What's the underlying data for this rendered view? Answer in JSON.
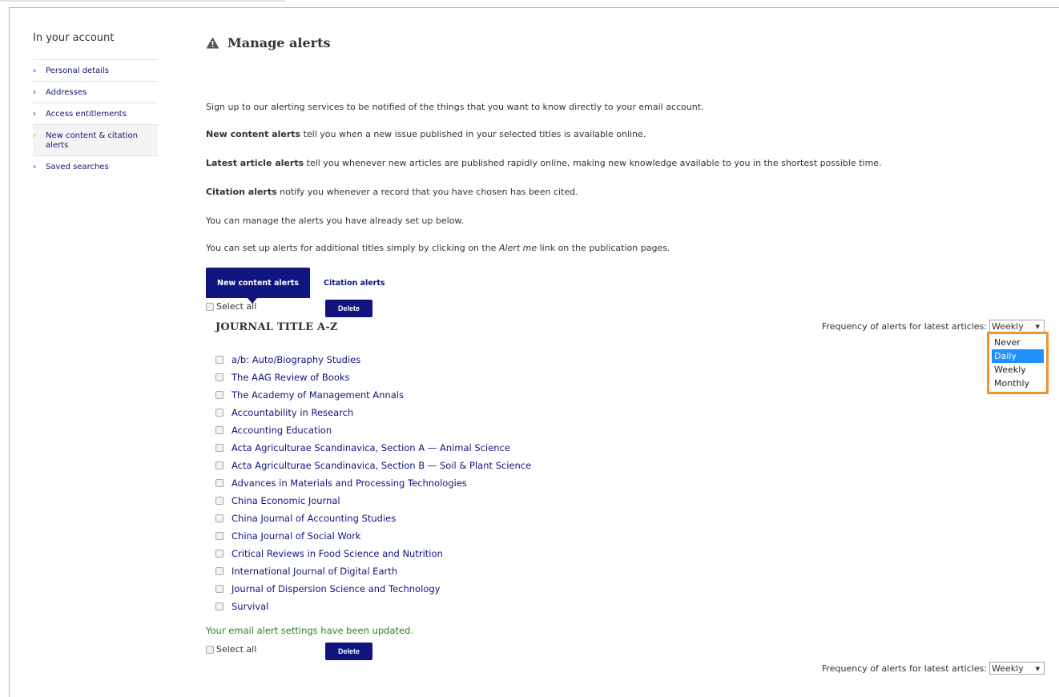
{
  "sidebar": {
    "title": "In your account",
    "items": [
      {
        "label": "Personal details",
        "active": false
      },
      {
        "label": "Addresses",
        "active": false
      },
      {
        "label": "Access entitlements",
        "active": false
      },
      {
        "label": "New content & citation alerts",
        "active": true
      },
      {
        "label": "Saved searches",
        "active": false
      }
    ]
  },
  "header": {
    "title": "Manage alerts",
    "icon": "warning-icon"
  },
  "intro": {
    "p1": "Sign up to our alerting services to be notified of the things that you want to know directly to your email account.",
    "p2_bold": "New content alerts",
    "p2_rest": " tell you when a new issue published in your selected titles is available online.",
    "p3_bold": "Latest article alerts",
    "p3_rest": " tell you whenever new articles are published rapidly online, making new knowledge available to you in the shortest possible time.",
    "p4_bold": "Citation alerts",
    "p4_rest": " notify you whenever a record that you have chosen has been cited.",
    "p5": "You can manage the alerts you have already set up below.",
    "p6_pre": "You can set up alerts for additional titles simply by clicking on the ",
    "p6_em": "Alert me",
    "p6_post": " link on the publication pages."
  },
  "tabs": {
    "active": "New content alerts",
    "other": "Citation alerts"
  },
  "controls": {
    "select_all": "Select all",
    "delete": "Delete",
    "frequency_label": "Frequency of alerts for latest articles:",
    "frequency_value": "Weekly",
    "frequency_options": [
      "Never",
      "Daily",
      "Weekly",
      "Monthly"
    ],
    "frequency_highlighted": "Daily"
  },
  "journals": {
    "heading": "JOURNAL TITLE A-Z",
    "items": [
      "a/b: Auto/Biography Studies",
      "The AAG Review of Books",
      "The Academy of Management Annals",
      "Accountability in Research",
      "Accounting Education",
      "Acta Agriculturae Scandinavica, Section A — Animal Science",
      "Acta Agriculturae Scandinavica, Section B — Soil & Plant Science",
      "Advances in Materials and Processing Technologies",
      "China Economic Journal",
      "China Journal of Accounting Studies",
      "China Journal of Social Work",
      "Critical Reviews in Food Science and Nutrition",
      "International Journal of Digital Earth",
      "Journal of Dispersion Science and Technology",
      "Survival"
    ]
  },
  "status": {
    "message": "Your email alert settings have been updated."
  },
  "colors": {
    "brand": "#10147e",
    "highlight": "#f0932a",
    "success": "#2e7d32",
    "selected_option": "#1e90ff"
  }
}
